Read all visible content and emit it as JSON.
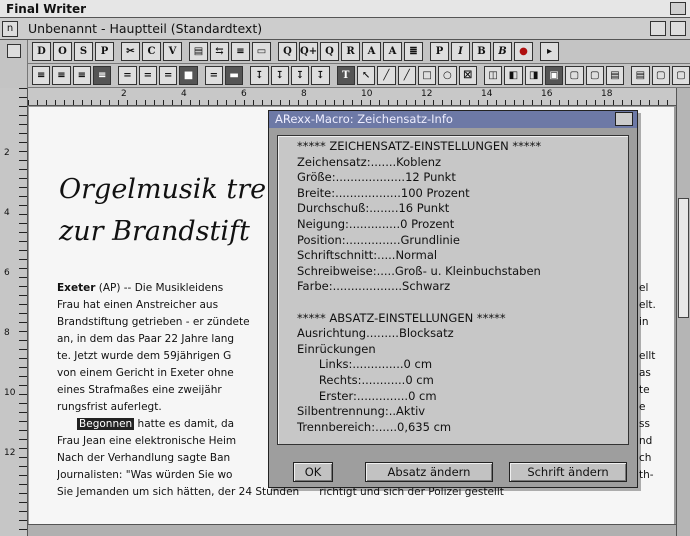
{
  "screen": {
    "title": "Final Writer"
  },
  "window": {
    "title": "Unbenannt - Hauptteil (Standardtext)",
    "close_glyph": "n"
  },
  "toolbar1": {
    "buttons": [
      "D",
      "O",
      "S",
      "P",
      "✂",
      "C",
      "V",
      "▤",
      "⇆",
      "≡",
      "▭",
      "Q",
      "Q+",
      "Q",
      "R",
      "A",
      "A",
      "≣",
      "P",
      "I",
      "B",
      "B",
      "●",
      "▸"
    ]
  },
  "toolbar2": {
    "buttons": [
      "≡",
      "≡",
      "≡",
      "≡",
      "=",
      "=",
      "=",
      "■",
      "=",
      "▬",
      "↧",
      "↧",
      "↧",
      "↧",
      "T",
      "↖",
      "╱",
      "╱",
      "□",
      "○",
      "☒",
      "◫",
      "◧",
      "◨",
      "▣",
      "▢",
      "▢",
      "▤",
      "▤",
      "▢",
      "▢"
    ]
  },
  "ruler": {
    "numbers": [
      "2",
      "4",
      "6",
      "8",
      "10",
      "12",
      "14",
      "16",
      "18"
    ]
  },
  "vruler": {
    "numbers": [
      "2",
      "4",
      "6",
      "8",
      "10",
      "12"
    ]
  },
  "document": {
    "headline_1": "Orgelmusik tre",
    "headline_2": "zur Brandstift",
    "lines": [
      {
        "lead": "Exeter",
        "text": " (AP) -- Die Musikleidens"
      },
      {
        "text": "Frau hat einen Anstreicher aus"
      },
      {
        "text": "Brandstiftung getrieben - er zündete"
      },
      {
        "text": "an, in dem das Paar 22 Jahre lang"
      },
      {
        "text": "te. Jetzt wurde dem 59jährigen G"
      },
      {
        "text": "von einem Gericht in Exeter ohne"
      },
      {
        "text": "eines Strafmaßes eine zweijähr"
      },
      {
        "text": "rungsfrist auferlegt."
      },
      {
        "highlight": "Begonnen",
        "text": " hatte es damit, da"
      },
      {
        "text": "Frau Jean eine elektronische Heim"
      },
      {
        "text": "Nach der Verhandlung sagte Ban"
      },
      {
        "text": "Journalisten: \"Was würden Sie wo"
      },
      {
        "text": "Sie Jemanden um sich hätten, der 24 Stunden      richtigt und sich der Polizei gestellt"
      }
    ],
    "right_fragments": [
      "el",
      "elt.",
      "in",
      "",
      "ellt",
      "as",
      "te",
      "e",
      "ss",
      "nd",
      "ch",
      "th-"
    ]
  },
  "dialog": {
    "title": "ARexx-Macro: Zeichensatz-Info",
    "lines": [
      "***** ZEICHENSATZ-EINSTELLUNGEN *****",
      "Zeichensatz:.......Koblenz",
      "Größe:...................12 Punkt",
      "Breite:..................100 Prozent",
      "Durchschuß:........16 Punkt",
      "Neigung:..............0 Prozent",
      "Position:...............Grundlinie",
      "Schriftschnitt:.....Normal",
      "Schreibweise:.....Groß- u. Kleinbuchstaben",
      "Farbe:...................Schwarz",
      "",
      "***** ABSATZ-EINSTELLUNGEN *****",
      "Ausrichtung.........Blocksatz",
      "Einrückungen",
      "      Links:..............0 cm",
      "      Rechts:............0 cm",
      "      Erster:..............0 cm",
      "Silbentrennung:..Aktiv",
      "Trennbereich:......0,635 cm"
    ],
    "buttons": {
      "ok": "OK",
      "absatz": "Absatz ändern",
      "schrift": "Schrift ändern"
    }
  }
}
